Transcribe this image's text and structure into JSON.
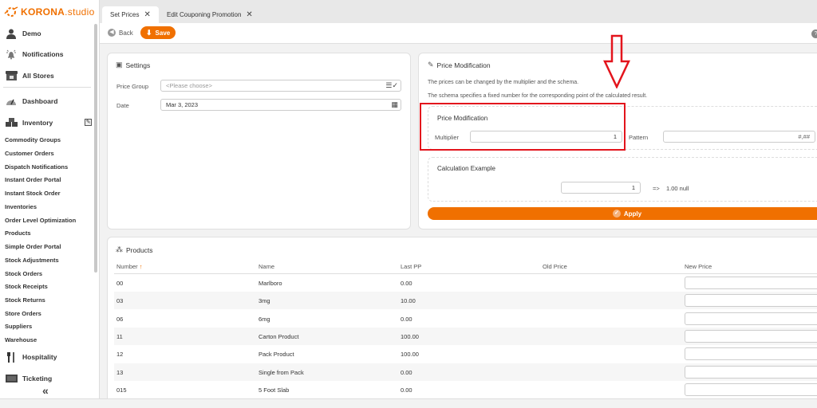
{
  "app": {
    "brand": "KORONA",
    "brand_suffix": ".studio",
    "brand_color": "#f07000"
  },
  "sidebar": {
    "main_items": [
      {
        "label": "Demo",
        "icon": "user-icon"
      },
      {
        "label": "Notifications",
        "icon": "bell-icon"
      },
      {
        "label": "All Stores",
        "icon": "store-icon"
      },
      {
        "label": "Dashboard",
        "icon": "gauge-icon"
      },
      {
        "label": "Inventory",
        "icon": "boxes-icon"
      }
    ],
    "inventory_items": [
      "Commodity Groups",
      "Customer Orders",
      "Dispatch Notifications",
      "Instant Order Portal",
      "Instant Stock Order",
      "Inventories",
      "Order Level Optimization",
      "Products",
      "Simple Order Portal",
      "Stock Adjustments",
      "Stock Orders",
      "Stock Receipts",
      "Stock Returns",
      "Store Orders",
      "Suppliers",
      "Warehouse"
    ],
    "bottom_items": [
      {
        "label": "Hospitality",
        "icon": "cutlery-icon"
      },
      {
        "label": "Ticketing",
        "icon": "ticket-icon"
      }
    ],
    "collapse_label": "«"
  },
  "tabs": [
    {
      "label": "Set Prices",
      "active": true
    },
    {
      "label": "Edit Couponing Promotion",
      "active": false
    }
  ],
  "toolbar": {
    "back_label": "Back",
    "save_label": "Save",
    "help_label": "?"
  },
  "settings": {
    "title": "Settings",
    "price_group_label": "Price Group",
    "price_group_placeholder": "<Please choose>",
    "date_label": "Date",
    "date_value": "Mar 3, 2023"
  },
  "price_modification": {
    "title": "Price Modification",
    "desc1": "The prices can be changed by the multiplier and the schema.",
    "desc2": "The schema specifies a fixed number for the corresponding point of the calculated result.",
    "box_title": "Price Modification",
    "multiplier_label": "Multiplier",
    "multiplier_value": "1",
    "pattern_label": "Pattern",
    "pattern_value": "#,##",
    "calc_title": "Calculation Example",
    "calc_input": "1",
    "calc_arrow": "=>",
    "calc_result": "1.00 null",
    "apply_label": "Apply"
  },
  "products": {
    "title": "Products",
    "columns": [
      "Number",
      "Name",
      "Last PP",
      "Old Price",
      "New Price"
    ],
    "sort_indicator": "↑",
    "rows": [
      {
        "number": "00",
        "name": "Marlboro",
        "last_pp": "0.00",
        "old_price": "",
        "new_price": ""
      },
      {
        "number": "03",
        "name": "3mg",
        "last_pp": "10.00",
        "old_price": "",
        "new_price": ""
      },
      {
        "number": "06",
        "name": "6mg",
        "last_pp": "0.00",
        "old_price": "",
        "new_price": ""
      },
      {
        "number": "11",
        "name": "Carton Product",
        "last_pp": "100.00",
        "old_price": "",
        "new_price": ""
      },
      {
        "number": "12",
        "name": "Pack Product",
        "last_pp": "100.00",
        "old_price": "",
        "new_price": ""
      },
      {
        "number": "13",
        "name": "Single from Pack",
        "last_pp": "0.00",
        "old_price": "",
        "new_price": ""
      },
      {
        "number": "015",
        "name": "5 Foot Slab",
        "last_pp": "0.00",
        "old_price": "",
        "new_price": ""
      }
    ]
  },
  "annotation": {
    "color": "#e3141c"
  }
}
